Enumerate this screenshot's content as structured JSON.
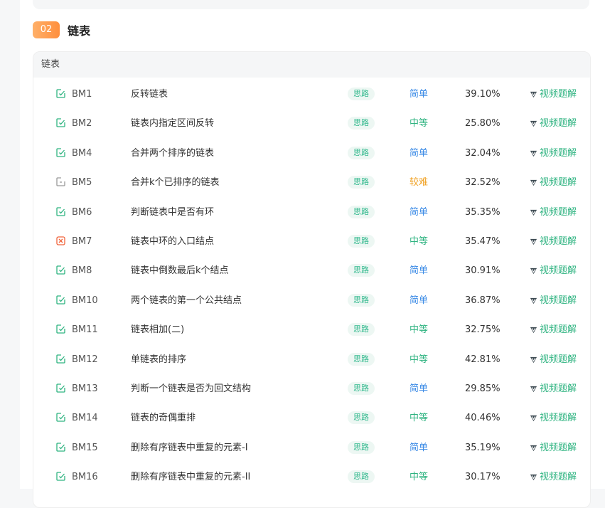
{
  "section": {
    "number": "02",
    "title": "链表",
    "list_header": "链表"
  },
  "tag_label": "思路",
  "video_label": "视频题解",
  "problems": [
    {
      "id": "BM1",
      "title": "反转链表",
      "difficulty": "简单",
      "level": "easy",
      "rate": "39.10%",
      "status": "done"
    },
    {
      "id": "BM2",
      "title": "链表内指定区间反转",
      "difficulty": "中等",
      "level": "mid",
      "rate": "25.80%",
      "status": "done"
    },
    {
      "id": "BM4",
      "title": "合并两个排序的链表",
      "difficulty": "简单",
      "level": "easy",
      "rate": "32.04%",
      "status": "done"
    },
    {
      "id": "BM5",
      "title": "合并k个已排序的链表",
      "difficulty": "较难",
      "level": "hard",
      "rate": "32.52%",
      "status": "todo"
    },
    {
      "id": "BM6",
      "title": "判断链表中是否有环",
      "difficulty": "简单",
      "level": "easy",
      "rate": "35.35%",
      "status": "done"
    },
    {
      "id": "BM7",
      "title": "链表中环的入口结点",
      "difficulty": "中等",
      "level": "mid",
      "rate": "35.47%",
      "status": "failed"
    },
    {
      "id": "BM8",
      "title": "链表中倒数最后k个结点",
      "difficulty": "简单",
      "level": "easy",
      "rate": "30.91%",
      "status": "done"
    },
    {
      "id": "BM10",
      "title": "两个链表的第一个公共结点",
      "difficulty": "简单",
      "level": "easy",
      "rate": "36.87%",
      "status": "done"
    },
    {
      "id": "BM11",
      "title": "链表相加(二)",
      "difficulty": "中等",
      "level": "mid",
      "rate": "32.75%",
      "status": "done"
    },
    {
      "id": "BM12",
      "title": "单链表的排序",
      "difficulty": "中等",
      "level": "mid",
      "rate": "42.81%",
      "status": "done"
    },
    {
      "id": "BM13",
      "title": "判断一个链表是否为回文结构",
      "difficulty": "简单",
      "level": "easy",
      "rate": "29.85%",
      "status": "done"
    },
    {
      "id": "BM14",
      "title": "链表的奇偶重排",
      "difficulty": "中等",
      "level": "mid",
      "rate": "40.46%",
      "status": "done"
    },
    {
      "id": "BM15",
      "title": "删除有序链表中重复的元素-I",
      "difficulty": "简单",
      "level": "easy",
      "rate": "35.19%",
      "status": "done"
    },
    {
      "id": "BM16",
      "title": "删除有序链表中重复的元素-II",
      "difficulty": "中等",
      "level": "mid",
      "rate": "30.17%",
      "status": "done"
    }
  ],
  "colors": {
    "done": "#2eb380",
    "todo": "#999999",
    "failed": "#f0643c",
    "easy": "#3a8ae6",
    "mid": "#2eb380",
    "hard": "#f0a020"
  }
}
